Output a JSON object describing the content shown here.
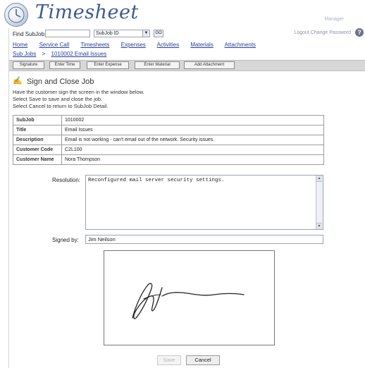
{
  "header": {
    "app_title": "Timesheet",
    "user_name": "Manager"
  },
  "find": {
    "label": "Find SubJob:",
    "input_value": "",
    "select_value": "SubJob ID",
    "go_label": "GO"
  },
  "top_links": "Logout Change Password",
  "nav": {
    "items": [
      "Home",
      "Service Call",
      "Timesheets",
      "Expenses",
      "Activities",
      "Materials",
      "Attachments"
    ]
  },
  "breadcrumb": {
    "first": "Sub Jobs",
    "separator": ">",
    "second": "1010002 Email Issues"
  },
  "toolbar": {
    "buttons": [
      "Signature",
      "Enter Time",
      "Enter Expense",
      "Enter Material",
      "Add Attachment"
    ]
  },
  "page": {
    "title": "Sign and Close Job",
    "instructions": [
      "Have the customer sign the screen in the window below.",
      "Select Save to save and close the job.",
      "Select Cancel to return to SubJob Detail."
    ]
  },
  "details": [
    {
      "key": "SubJob",
      "value": "1010002"
    },
    {
      "key": "Title",
      "value": "Email Issues"
    },
    {
      "key": "Description",
      "value": "Email is not working - can't email out of the network. Security issues."
    },
    {
      "key": "Customer Code",
      "value": "C2L100"
    },
    {
      "key": "Customer Name",
      "value": "Nora Thompson"
    }
  ],
  "resolution": {
    "label": "Resolution:",
    "value": "Reconfigured mail server security settings."
  },
  "signed_by": {
    "label": "Signed by:",
    "value": "Jim Neilson"
  },
  "actions": {
    "save_label": "Save",
    "cancel_label": "Cancel"
  }
}
